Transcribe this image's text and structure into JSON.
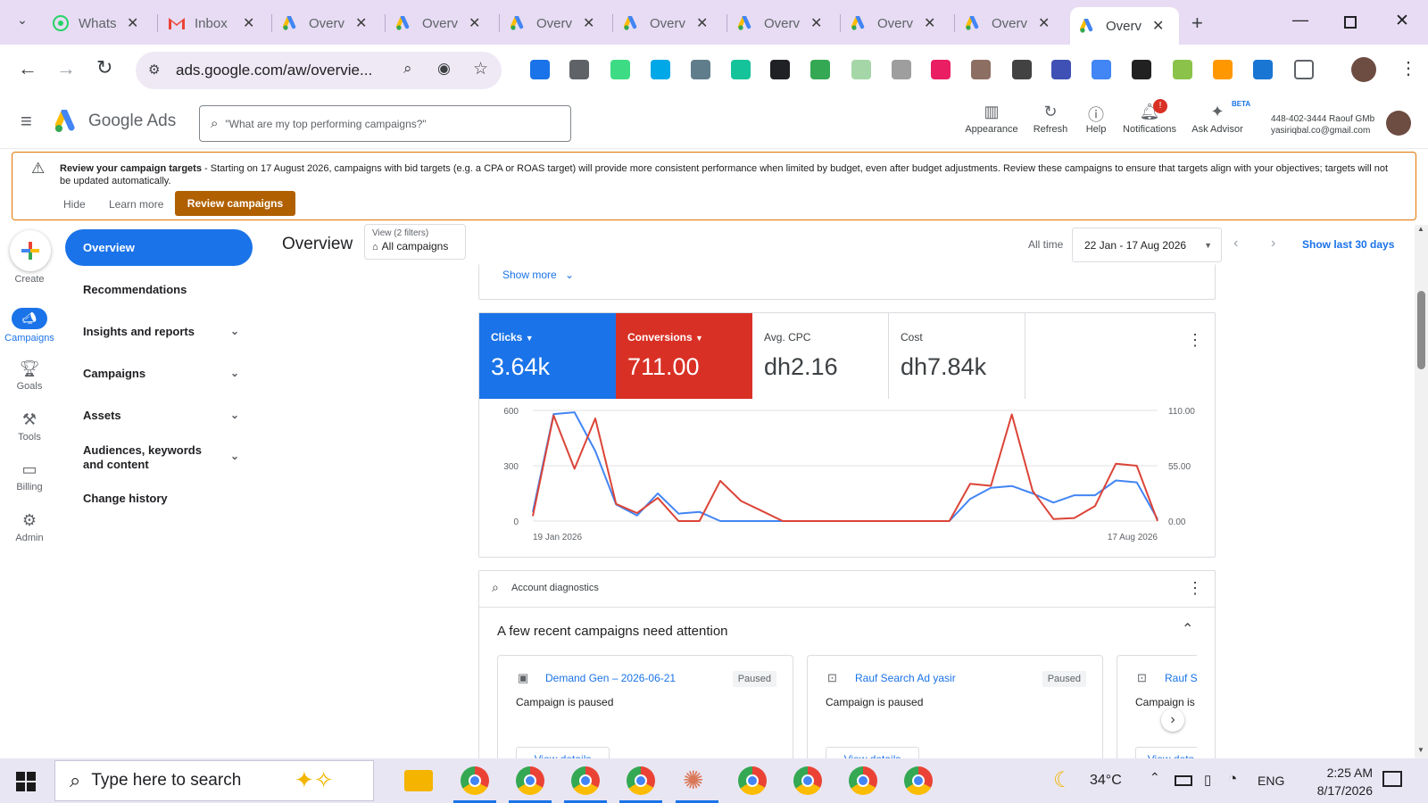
{
  "browser": {
    "tabs": [
      {
        "title": "WhatsApp",
        "icon": "whatsapp-icon"
      },
      {
        "title": "Inbox",
        "icon": "gmail-icon"
      },
      {
        "title": "Overview",
        "icon": "google-ads-icon"
      },
      {
        "title": "Overview",
        "icon": "google-ads-icon"
      },
      {
        "title": "Overview",
        "icon": "google-ads-icon"
      },
      {
        "title": "Overview",
        "icon": "google-ads-icon"
      },
      {
        "title": "Overview",
        "icon": "google-ads-icon"
      },
      {
        "title": "Overview",
        "icon": "google-ads-icon"
      },
      {
        "title": "Overview",
        "icon": "google-ads-icon"
      },
      {
        "title": "Overview",
        "icon": "google-ads-icon"
      }
    ],
    "url": "ads.google.com/aw/overvie..."
  },
  "header": {
    "logo": "Google Ads",
    "search_placeholder": "\"What are my top performing campaigns?\"",
    "buttons": [
      {
        "label": "Appearance",
        "icon": "appearance-icon"
      },
      {
        "label": "Refresh",
        "icon": "refresh-icon"
      },
      {
        "label": "Help",
        "icon": "help-icon"
      },
      {
        "label": "Notifications",
        "icon": "bell-icon",
        "badge": "!"
      },
      {
        "label": "Ask Advisor",
        "icon": "sparkle-icon",
        "beta": "BETA"
      }
    ],
    "account_id": "448-402-3444 Raouf GMb",
    "account_email": "yasiriqbal.co@gmail.com"
  },
  "banner": {
    "title": "Review your campaign targets",
    "text": " - Starting on 17 August 2026, campaigns with bid targets (e.g. a CPA or ROAS target) will provide more consistent performance when limited by budget, even after budget adjustments. Review these campaigns to ensure that targets align with your objectives; targets will not be updated automatically.",
    "hide": "Hide",
    "learn_more": "Learn more",
    "review": "Review campaigns"
  },
  "rail": [
    {
      "label": "Create",
      "icon": "plus-icon"
    },
    {
      "label": "Campaigns",
      "icon": "megaphone-icon"
    },
    {
      "label": "Goals",
      "icon": "trophy-icon"
    },
    {
      "label": "Tools",
      "icon": "tools-icon"
    },
    {
      "label": "Billing",
      "icon": "billing-icon"
    },
    {
      "label": "Admin",
      "icon": "gear-icon"
    }
  ],
  "nav": {
    "overview": "Overview",
    "items": [
      "Recommendations",
      "Insights and reports",
      "Campaigns",
      "Assets",
      "Audiences, keywords and content",
      "Change history"
    ]
  },
  "page": {
    "title": "Overview",
    "view_label": "View (2 filters)",
    "view_value": "All campaigns",
    "all_time": "All time",
    "date_range": "22 Jan - 17 Aug 2026",
    "show_last": "Show last 30 days",
    "show_more": "Show more"
  },
  "metrics": [
    {
      "label": "Clicks",
      "value": "3.64k",
      "color": "#1a73e8"
    },
    {
      "label": "Conversions",
      "value": "711.00",
      "color": "#d93025"
    },
    {
      "label": "Avg. CPC",
      "value": "dh2.16"
    },
    {
      "label": "Cost",
      "value": "dh7.84k"
    }
  ],
  "chart_data": {
    "type": "line",
    "x_labels": [
      "19 Jan 2026",
      "17 Aug 2026"
    ],
    "left_axis": {
      "ticks": [
        "600",
        "300",
        "0"
      ],
      "ylim": [
        0,
        600
      ]
    },
    "right_axis": {
      "ticks": [
        "110.00",
        "55.00",
        "0.00"
      ],
      "ylim": [
        0,
        110
      ]
    },
    "grid": true,
    "series": [
      {
        "name": "Clicks",
        "axis": "left",
        "color": "#4285f4",
        "values": [
          50,
          580,
          590,
          380,
          90,
          30,
          150,
          40,
          50,
          0,
          0,
          0,
          0,
          0,
          0,
          0,
          0,
          0,
          0,
          0,
          0,
          120,
          180,
          190,
          150,
          100,
          140,
          140,
          220,
          210,
          10
        ]
      },
      {
        "name": "Conversions",
        "axis": "right",
        "color": "#db4437",
        "values": [
          5,
          105,
          52,
          102,
          17,
          8,
          23,
          0,
          0,
          40,
          20,
          10,
          0,
          0,
          0,
          0,
          0,
          0,
          0,
          0,
          0,
          37,
          35,
          106,
          30,
          2,
          3,
          15,
          57,
          55,
          0
        ]
      }
    ]
  },
  "diagnostics": {
    "title": "Account diagnostics",
    "heading": "A few recent campaigns need attention",
    "cards": [
      {
        "name": "Demand Gen – 2026-06-21",
        "status": "Paused",
        "message": "Campaign is paused",
        "button": "View details",
        "icon": "demand-gen-icon"
      },
      {
        "name": "Rauf Search Ad yasir",
        "status": "Paused",
        "message": "Campaign is paused",
        "button": "View details",
        "icon": "search-campaign-icon"
      },
      {
        "name": "Rauf Se",
        "status": "",
        "message": "Campaign is",
        "button": "View deta",
        "icon": "search-campaign-icon"
      }
    ]
  },
  "taskbar": {
    "search_placeholder": "Type here to search",
    "weather": "34°C",
    "language": "ENG",
    "time": "2:25 AM",
    "date": "8/17/2026"
  }
}
